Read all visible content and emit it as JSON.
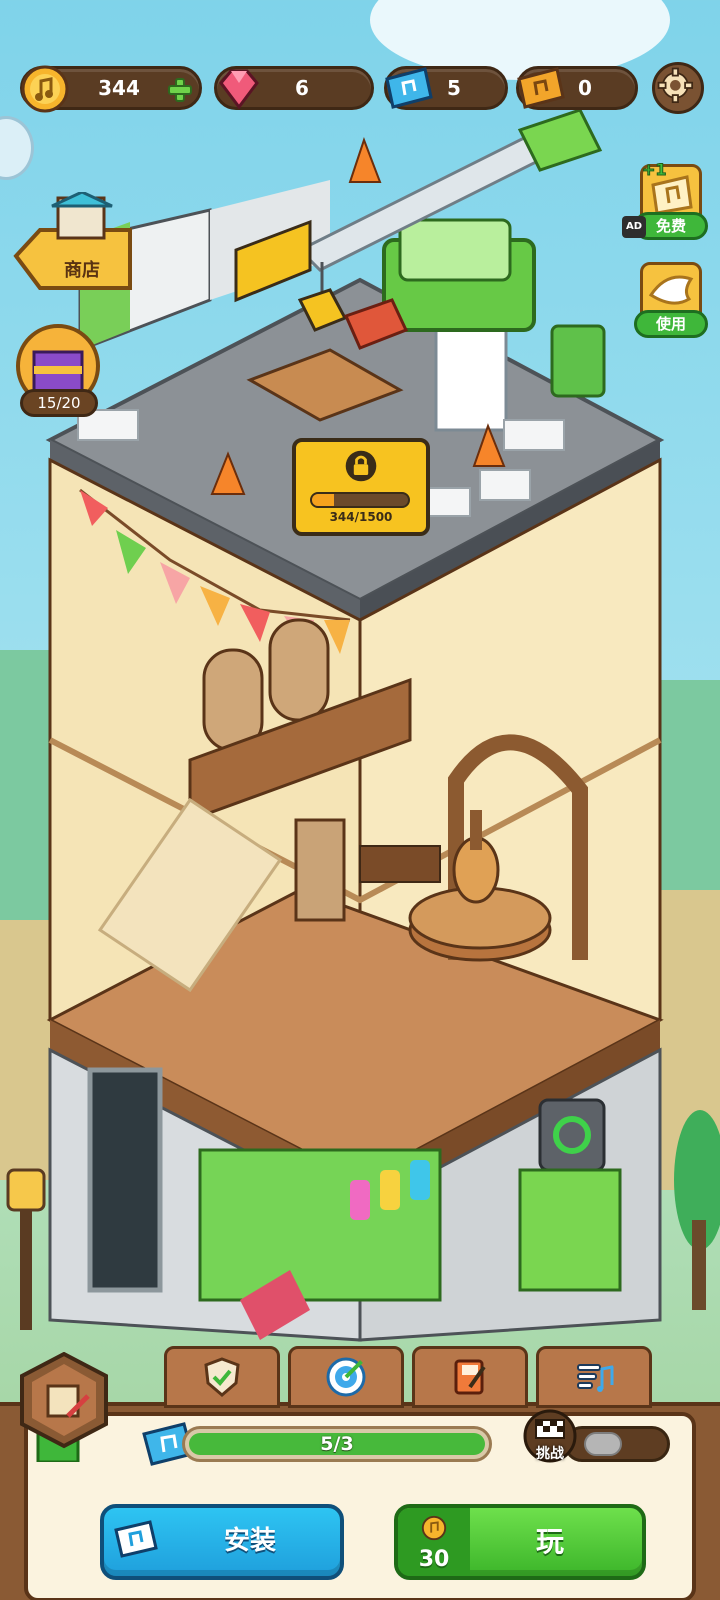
{
  "currencies": {
    "notes": "344",
    "gems": "6",
    "blue_tickets": "5",
    "gold_tickets": "0"
  },
  "left_menu": {
    "shop_label": "商店",
    "chest_count": "15/20"
  },
  "right_menu": {
    "free_plus": "+1",
    "ad_badge": "AD",
    "free_label": "免费",
    "use_label": "使用"
  },
  "locked_floor": {
    "progress_text": "344/1500",
    "progress_fraction": 0.23
  },
  "bottom_tabs": [
    {
      "icon": "shield-check-icon"
    },
    {
      "icon": "target-dart-icon"
    },
    {
      "icon": "brush-book-icon"
    },
    {
      "icon": "music-list-icon"
    }
  ],
  "bottom_panel": {
    "ticket_progress_text": "5/3",
    "ticket_progress_fraction": 1.0,
    "challenge_label": "挑战",
    "challenge_enabled": false,
    "install_label": "安装",
    "play_label": "玩",
    "play_cost": "30"
  },
  "colors": {
    "sky": "#7fd3ea",
    "wood": "#8a5a34",
    "panel": "#fbf3df",
    "install_blue": "#1f9fdc",
    "play_green": "#3cb52a",
    "progress_green": "#47b93b",
    "lock_yellow": "#f7c320"
  }
}
